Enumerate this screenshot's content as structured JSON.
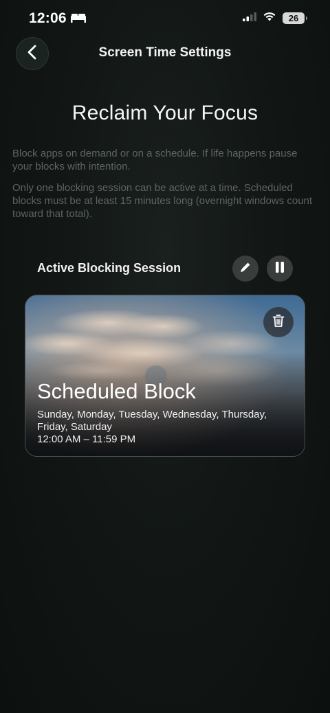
{
  "status_bar": {
    "time": "12:06",
    "battery": "26"
  },
  "header": {
    "title": "Screen Time Settings"
  },
  "hero": {
    "title": "Reclaim Your Focus",
    "description_1": "Block apps on demand or on a schedule. If life happens pause your blocks with intention.",
    "description_2": "Only one blocking session can be active at a time. Scheduled blocks must be at least 15 minutes long (overnight windows count toward that total)."
  },
  "active_session": {
    "label": "Active Blocking Session",
    "card": {
      "title": "Scheduled Block",
      "days": "Sunday, Monday, Tuesday, Wednesday, Thursday, Friday, Saturday",
      "time_range": "12:00 AM – 11:59 PM"
    }
  },
  "icons": {
    "back": "chevron-left-icon",
    "edit": "pencil-icon",
    "pause": "pause-icon",
    "delete": "trash-icon",
    "sleep": "bed-icon",
    "signal": "cellular-signal-icon",
    "wifi": "wifi-icon",
    "battery": "battery-icon"
  },
  "colors": {
    "background": "#121715",
    "muted_text": "#5e6462",
    "button_bg": "#393d3c"
  }
}
